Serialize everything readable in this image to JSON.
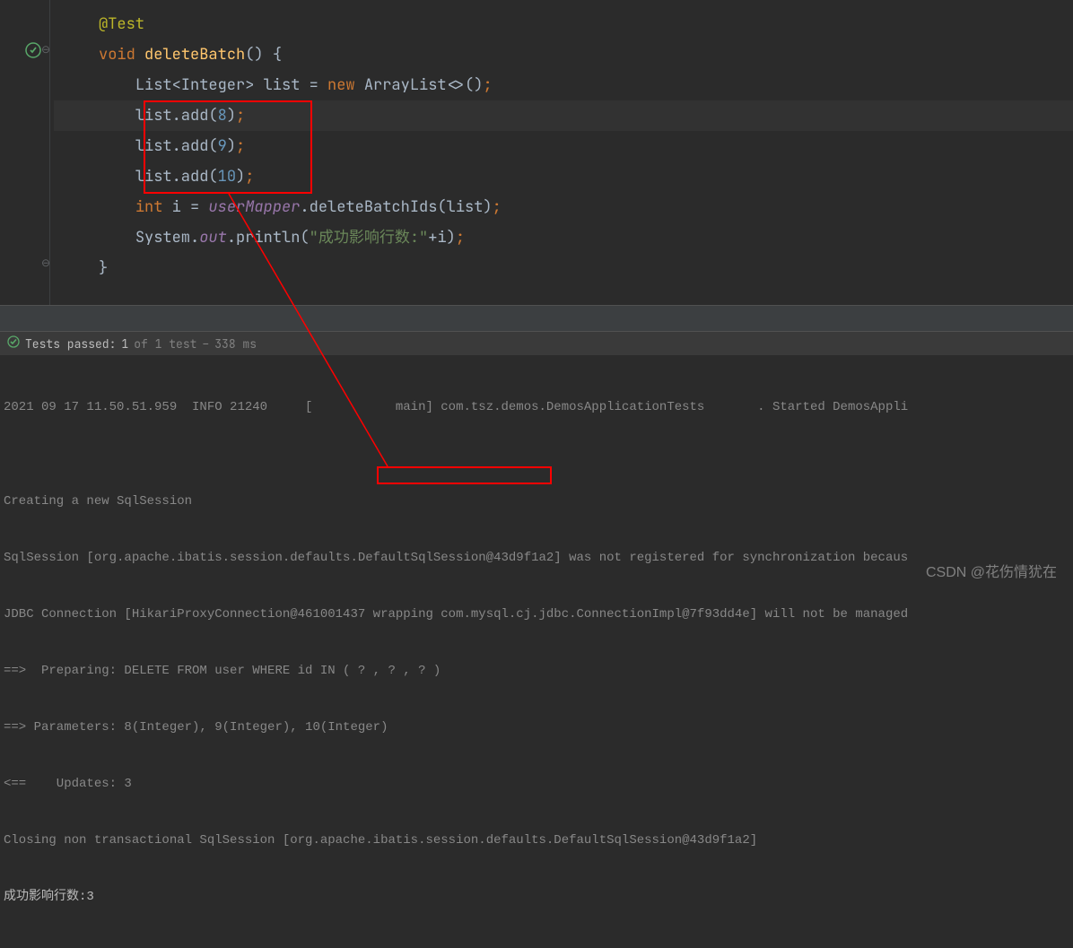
{
  "code": {
    "l1": "@Test",
    "l2_kw": "void",
    "l2_method": "deleteBatch",
    "l2_suffix": "() {",
    "l3_p1": "List<Integer> list = ",
    "l3_kw": "new",
    "l3_p2": " ArrayList<>()",
    "l3_sc": ";",
    "l4_p1": "list.add(",
    "l4_n": "8",
    "l4_p2": ")",
    "l4_sc": ";",
    "l5_p1": "list.add(",
    "l5_n": "9",
    "l5_p2": ")",
    "l5_sc": ";",
    "l6_p1": "list.add(",
    "l6_n": "10",
    "l6_p2": ")",
    "l6_sc": ";",
    "l7_kw": "int",
    "l7_p1": " i = ",
    "l7_field": "userMapper",
    "l7_p2": ".deleteBatchIds(list)",
    "l7_sc": ";",
    "l8_p1": "System.",
    "l8_field": "out",
    "l8_p2": ".println(",
    "l8_str": "\"成功影响行数:\"",
    "l8_p3": "+i)",
    "l8_sc": ";",
    "l9": "}"
  },
  "test_status": {
    "label_prefix": "Tests passed:",
    "passed": "1",
    "of": "of 1 test",
    "dash": "–",
    "time": "338 ms"
  },
  "console": {
    "l0": "2021 09 17 11.50.51.959  INFO 21240     [           main] com.tsz.demos.DemosApplicationTests       . Started DemosAppli",
    "l1": "",
    "l2": "Creating a new SqlSession",
    "l3": "SqlSession [org.apache.ibatis.session.defaults.DefaultSqlSession@43d9f1a2] was not registered for synchronization becaus",
    "l4": "JDBC Connection [HikariProxyConnection@461001437 wrapping com.mysql.cj.jdbc.ConnectionImpl@7f93dd4e] will not be managed",
    "l5": "==>  Preparing: DELETE FROM user WHERE id IN ( ? , ? , ? )",
    "l6": "==> Parameters: 8(Integer), 9(Integer), 10(Integer)",
    "l7": "<==    Updates: 3",
    "l8": "Closing non transactional SqlSession [org.apache.ibatis.session.defaults.DefaultSqlSession@43d9f1a2]",
    "l9": "成功影响行数:3"
  },
  "watermark": "CSDN @花伤情犹在"
}
